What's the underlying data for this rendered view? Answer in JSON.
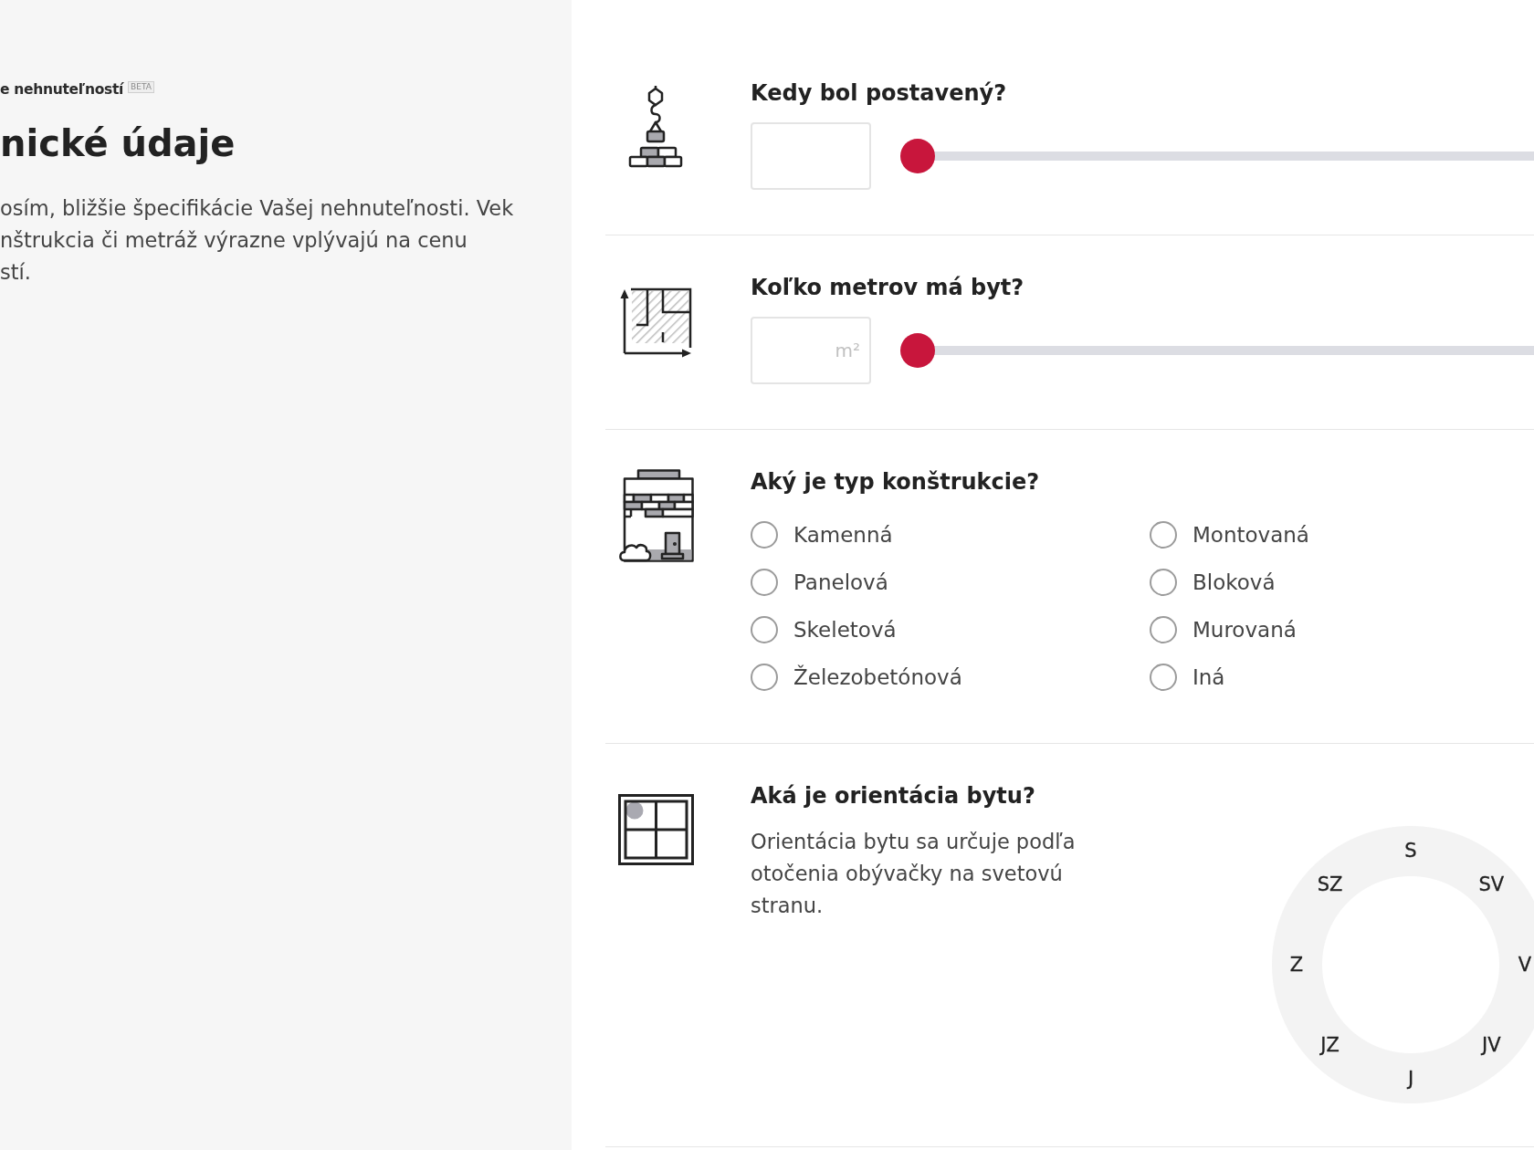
{
  "sidebar": {
    "breadcrumb": "e nehnuteľností",
    "badge": "BETA",
    "title": "nické údaje",
    "intro": "osím, bližšie špecifikácie Vašej nehnuteľnosti. Vek\nnštrukcia či metráž výrazne vplývajú na cenu\nstí."
  },
  "questions": [
    {
      "kind": "slider",
      "title": "Kedy bol postavený?",
      "level": 0
    },
    {
      "kind": "slider",
      "title": "Koľko metrov má byt?",
      "placeholder": "m²",
      "level": 0
    },
    {
      "kind": "choice",
      "title": "Aký je typ konštrukcie?",
      "options": [
        {
          "label": "Kamenná",
          "checked": false
        },
        {
          "label": "Montovaná",
          "checked": false
        },
        {
          "label": "Panelová",
          "checked": false
        },
        {
          "label": "Bloková",
          "checked": false
        },
        {
          "label": "Skeletová",
          "checked": false
        },
        {
          "label": "Murovaná",
          "checked": false
        },
        {
          "label": "Železobetónová",
          "checked": false
        },
        {
          "label": "Iná",
          "checked": false
        }
      ]
    },
    {
      "kind": "compass",
      "title": "Aká je orientácia bytu?",
      "description": "Orientácia bytu sa určuje podľa otočenia obývačky na svetovú stranu.",
      "directions": [
        {
          "label": "S",
          "selected": false
        },
        {
          "label": "SV",
          "selected": false
        },
        {
          "label": "V",
          "selected": false
        },
        {
          "label": "JV",
          "selected": false
        },
        {
          "label": "J",
          "selected": false
        },
        {
          "label": "JZ",
          "selected": false
        },
        {
          "label": "Z",
          "selected": false
        },
        {
          "label": "SZ",
          "selected": false
        }
      ]
    }
  ]
}
